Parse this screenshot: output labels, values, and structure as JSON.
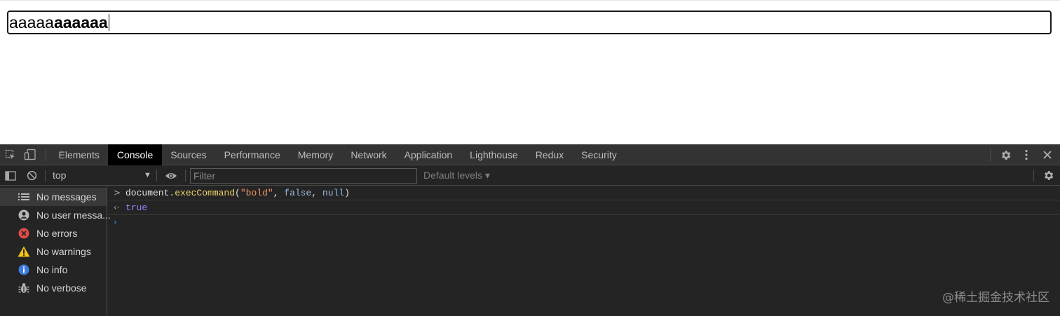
{
  "page": {
    "editor_text_plain": "aaaaa",
    "editor_text_bold": "aaaaaa"
  },
  "devtools": {
    "tabs": [
      "Elements",
      "Console",
      "Sources",
      "Performance",
      "Memory",
      "Network",
      "Application",
      "Lighthouse",
      "Redux",
      "Security"
    ],
    "active_tab": "Console",
    "context": "top",
    "filter_placeholder": "Filter",
    "levels_label": "Default levels ▾",
    "sidebar": [
      {
        "label": "No messages",
        "icon": "list-icon"
      },
      {
        "label": "No user messa...",
        "icon": "user-icon"
      },
      {
        "label": "No errors",
        "icon": "error-icon"
      },
      {
        "label": "No warnings",
        "icon": "warning-icon"
      },
      {
        "label": "No info",
        "icon": "info-icon"
      },
      {
        "label": "No verbose",
        "icon": "bug-icon"
      }
    ],
    "console": {
      "input_prompt": ">",
      "command_object": "document.",
      "command_method": "execCommand",
      "command_open": "(",
      "command_arg1": "\"bold\"",
      "command_sep1": ", ",
      "command_arg2": "false",
      "command_sep2": ", ",
      "command_arg3": "null",
      "command_close": ")",
      "result_prompt": "‹·",
      "result_value": "true",
      "empty_prompt": "›"
    },
    "colors": {
      "accent_error": "#e24a4a",
      "accent_warning": "#f5c518",
      "accent_info": "#3c7ce0"
    }
  },
  "watermark": "@稀土掘金技术社区"
}
